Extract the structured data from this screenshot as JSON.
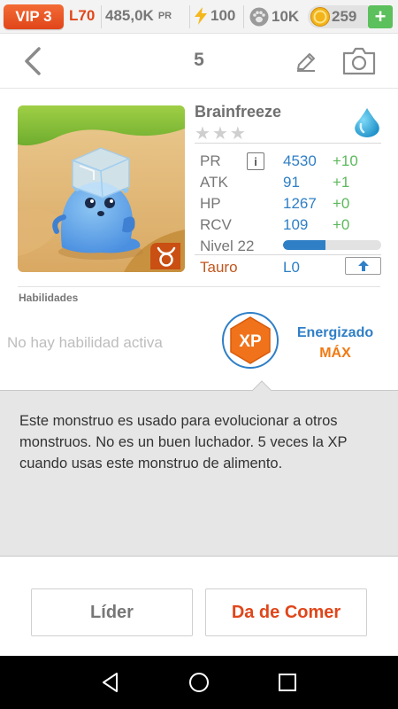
{
  "status_bar": {
    "vip": "VIP 3",
    "level": "L70",
    "pr": "485,0K",
    "pr_unit": "PR",
    "energy": "100",
    "food": "10K",
    "coins": "259",
    "add_label": "+"
  },
  "header": {
    "count": "5"
  },
  "monster": {
    "name": "Brainfreeze",
    "stars_total": 3,
    "stars_filled": 0,
    "element_icon": "water-drop-icon",
    "stats": [
      {
        "label": "PR",
        "value": "4530",
        "bonus": "+10"
      },
      {
        "label": "ATK",
        "value": "91",
        "bonus": "+1"
      },
      {
        "label": "HP",
        "value": "1267",
        "bonus": "+0"
      },
      {
        "label": "RCV",
        "value": "109",
        "bonus": "+0"
      }
    ],
    "level_label": "Nivel 22",
    "level_progress": 0.43,
    "zodiac": "Tauro",
    "rank": "L0",
    "info_icon": "i"
  },
  "skills": {
    "label": "Habilidades",
    "empty_text": "No hay habilidad activa",
    "badge_text": "XP",
    "energy_title": "Energizado",
    "energy_value": "MÁX"
  },
  "description": "Este monstruo es usado para evolucionar a otros monstruos. No es un buen luchador. 5 veces la XP cuando usas este monstruo de alimento.",
  "actions": {
    "leader": "Líder",
    "feed": "Da de Comer"
  },
  "colors": {
    "accent_orange": "#e0461a",
    "stat_blue": "#2f7fc6",
    "bonus_green": "#5cb85c",
    "energized_orange": "#f07a12"
  }
}
